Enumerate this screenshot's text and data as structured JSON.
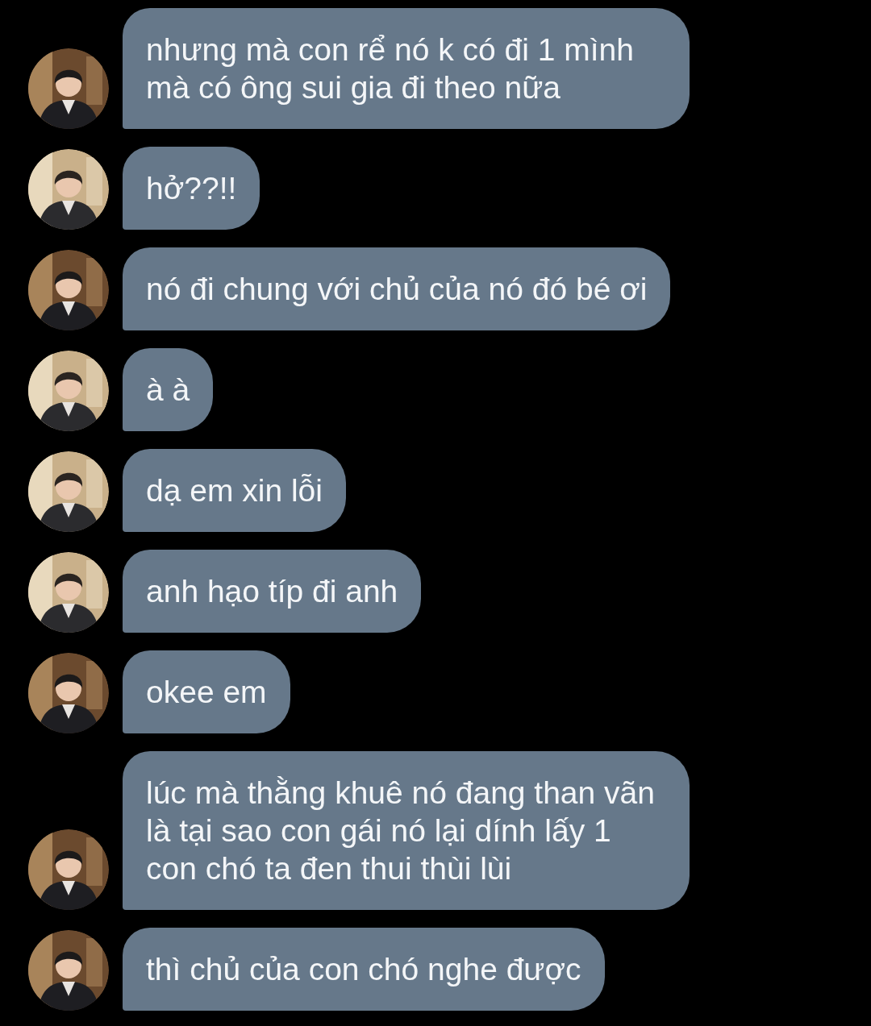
{
  "messages": [
    {
      "kind": "dark",
      "text": "nhưng mà con rể nó k có đi 1 mình mà có ông sui gia đi theo nữa"
    },
    {
      "kind": "light",
      "text": "hở??!!"
    },
    {
      "kind": "dark",
      "text": "nó đi chung với chủ của nó đó bé ơi"
    },
    {
      "kind": "light",
      "text": "à à"
    },
    {
      "kind": "light",
      "text": "dạ em xin lỗi"
    },
    {
      "kind": "light",
      "text": "anh hạo típ đi anh"
    },
    {
      "kind": "dark",
      "text": "okee em"
    },
    {
      "kind": "dark",
      "text": "lúc mà thằng khuê nó đang than vãn là tại sao con gái nó lại dính lấy 1 con chó ta đen thui thùi lùi"
    },
    {
      "kind": "dark",
      "text": "thì chủ của con chó nghe được"
    }
  ]
}
